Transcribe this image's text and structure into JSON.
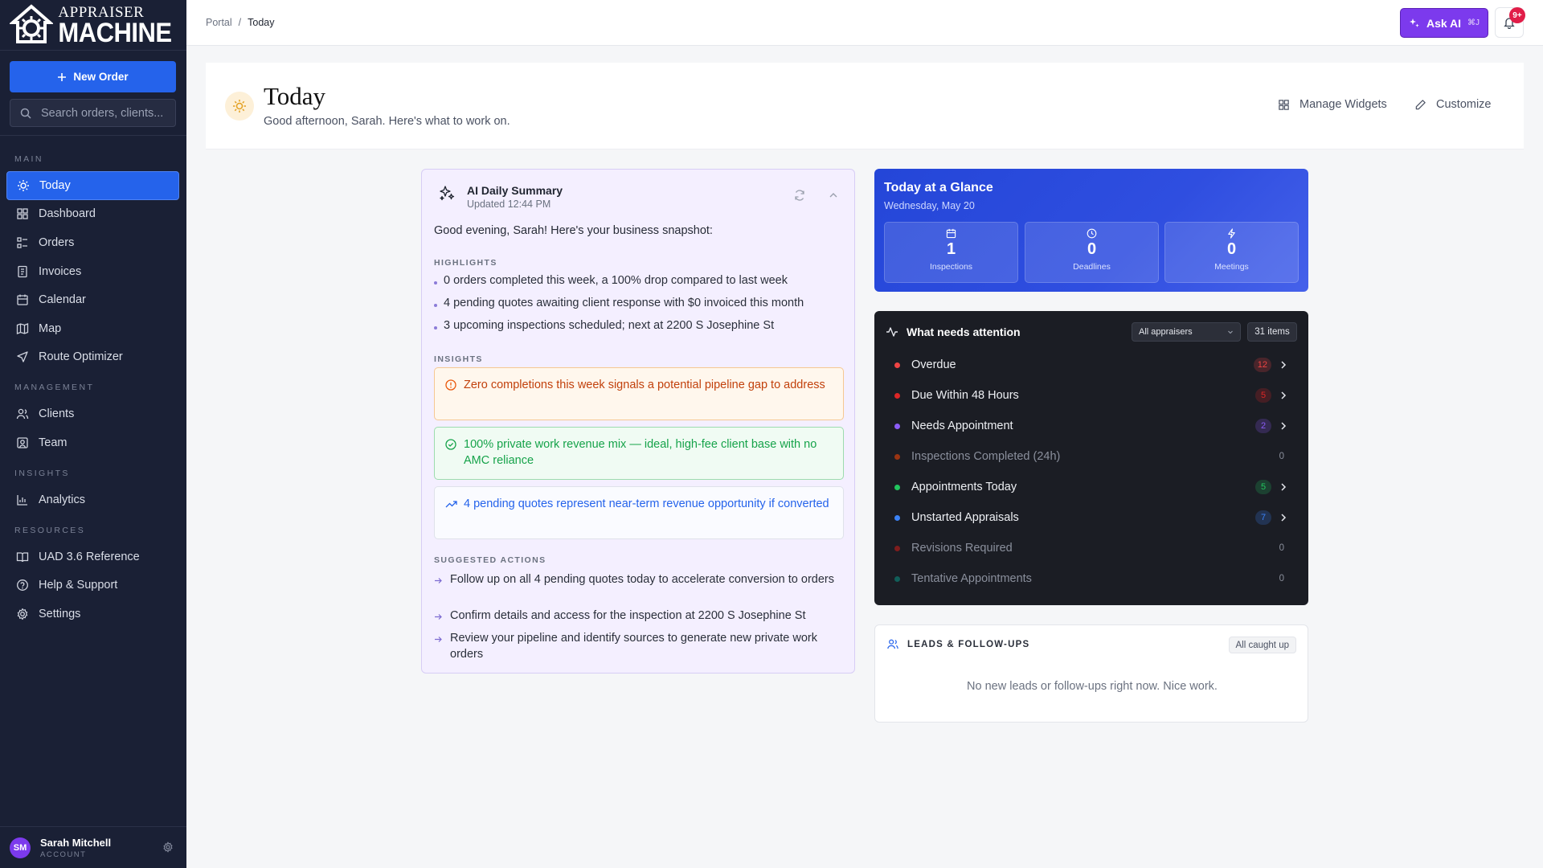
{
  "brand": {
    "line1": "APPRAISER",
    "line2": "MACHINE"
  },
  "sidebar": {
    "new_order_label": "New Order",
    "search_placeholder": "Search orders, clients...",
    "sections": {
      "main": "MAIN",
      "management": "MANAGEMENT",
      "insights": "INSIGHTS",
      "resources": "RESOURCES"
    },
    "items": [
      {
        "label": "Today",
        "icon": "sun-icon",
        "active": true
      },
      {
        "label": "Dashboard",
        "icon": "grid-icon"
      },
      {
        "label": "Orders",
        "icon": "list-icon"
      },
      {
        "label": "Invoices",
        "icon": "receipt-icon"
      },
      {
        "label": "Calendar",
        "icon": "calendar-icon"
      },
      {
        "label": "Map",
        "icon": "map-icon"
      },
      {
        "label": "Route Optimizer",
        "icon": "navigation-icon"
      },
      {
        "label": "Clients",
        "icon": "users-icon"
      },
      {
        "label": "Team",
        "icon": "team-icon"
      },
      {
        "label": "Analytics",
        "icon": "bar-chart-icon"
      },
      {
        "label": "UAD 3.6 Reference",
        "icon": "book-icon"
      },
      {
        "label": "Help & Support",
        "icon": "help-icon"
      },
      {
        "label": "Settings",
        "icon": "gear-icon"
      }
    ],
    "user": {
      "initials": "SM",
      "name": "Sarah Mitchell",
      "role": "ACCOUNT"
    }
  },
  "topbar": {
    "breadcrumb": [
      "Portal",
      "/",
      "Today"
    ],
    "ask_ai_label": "Ask AI",
    "ask_ai_shortcut": "⌘J",
    "notifications_badge": "9+"
  },
  "page": {
    "title": "Today",
    "subtitle": "Good afternoon, Sarah. Here's what to work on.",
    "manage_widgets_label": "Manage Widgets",
    "customize_label": "Customize"
  },
  "ai_summary": {
    "title": "AI Daily Summary",
    "updated": "Updated 12:44 PM",
    "greeting": "Good evening, Sarah! Here's your business snapshot:",
    "highlights_label": "HIGHLIGHTS",
    "highlights": [
      "0 orders completed this week, a 100% drop compared to last week",
      "4 pending quotes awaiting client response with $0 invoiced this month",
      "3 upcoming inspections scheduled; next at 2200 S Josephine St"
    ],
    "insights_label": "INSIGHTS",
    "insights": [
      {
        "tone": "warning",
        "text": "Zero completions this week signals a potential pipeline gap to address"
      },
      {
        "tone": "success",
        "text": "100% private work revenue mix — ideal, high-fee client base with no AMC reliance"
      },
      {
        "tone": "info",
        "text": "4 pending quotes represent near-term revenue opportunity if converted"
      }
    ],
    "actions_label": "SUGGESTED ACTIONS",
    "actions": [
      "Follow up on all 4 pending quotes today to accelerate conversion to orders",
      "Confirm details and access for the inspection at 2200 S Josephine St",
      "Review your pipeline and identify sources to generate new private work orders"
    ]
  },
  "glance": {
    "title": "Today at a Glance",
    "date": "Wednesday, May 20",
    "stats": [
      {
        "value": "1",
        "label": "Inspections",
        "icon": "calendar-icon"
      },
      {
        "value": "0",
        "label": "Deadlines",
        "icon": "clock-icon"
      },
      {
        "value": "0",
        "label": "Meetings",
        "icon": "bolt-icon"
      }
    ]
  },
  "attention": {
    "title": "What needs attention",
    "filter": "All appraisers",
    "count": "31 items",
    "rows": [
      {
        "label": "Overdue",
        "count": "12",
        "color": "#ef4444",
        "active": true
      },
      {
        "label": "Due Within 48 Hours",
        "count": "5",
        "color": "#dc2626",
        "active": true
      },
      {
        "label": "Needs Appointment",
        "count": "2",
        "color": "#8b5cf6",
        "active": true
      },
      {
        "label": "Inspections Completed (24h)",
        "count": "0",
        "color": "#9a3412",
        "active": false
      },
      {
        "label": "Appointments Today",
        "count": "5",
        "color": "#22c55e",
        "active": true
      },
      {
        "label": "Unstarted Appraisals",
        "count": "7",
        "color": "#3b82f6",
        "active": true
      },
      {
        "label": "Revisions Required",
        "count": "0",
        "color": "#7f1d1d",
        "active": false
      },
      {
        "label": "Tentative Appointments",
        "count": "0",
        "color": "#115e59",
        "active": false
      }
    ]
  },
  "leads": {
    "title": "LEADS & FOLLOW-UPS",
    "badge": "All caught up",
    "empty": "No new leads or follow-ups right now. Nice work."
  }
}
